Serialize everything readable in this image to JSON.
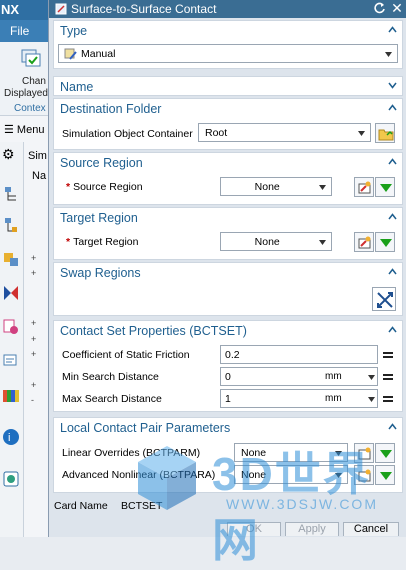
{
  "background": {
    "app_logo": "NX",
    "file_menu": "File",
    "ribbon_label_1": "Chan",
    "ribbon_label_2": "Displayed",
    "context_label": "Contex",
    "menu_label": "Menu",
    "navigator_label": "Sim",
    "column_label": "Na"
  },
  "dialog": {
    "title": "Surface-to-Surface Contact",
    "type": {
      "title": "Type",
      "selected": "Manual"
    },
    "name": {
      "title": "Name"
    },
    "destination": {
      "title": "Destination Folder",
      "label": "Simulation Object Container",
      "value": "Root"
    },
    "source": {
      "title": "Source Region",
      "label": "Source Region",
      "value": "None"
    },
    "target": {
      "title": "Target Region",
      "label": "Target Region",
      "value": "None"
    },
    "swap": {
      "title": "Swap Regions"
    },
    "contact_set": {
      "title": "Contact Set Properties (BCTSET)",
      "friction_label": "Coefficient of Static Friction",
      "friction_value": "0.2",
      "min_label": "Min Search Distance",
      "min_value": "0",
      "min_unit": "mm",
      "max_label": "Max Search Distance",
      "max_value": "1",
      "max_unit": "mm"
    },
    "local_pair": {
      "title": "Local Contact Pair Parameters",
      "linear_label": "Linear Overrides (BCTPARM)",
      "linear_value": "None",
      "advanced_label": "Advanced Nonlinear (BCTPARA)",
      "advanced_value": "None"
    },
    "card_name_label": "Card Name",
    "card_name_value": "BCTSET",
    "buttons": {
      "ok": "OK",
      "apply": "Apply",
      "cancel": "Cancel"
    }
  },
  "watermark": {
    "text": "3D世界网",
    "url": "WWW.3DSJW.COM"
  },
  "colors": {
    "title_bar": "#3a6d93",
    "section_title": "#1f5f8f",
    "required_mark": "#c00000",
    "accent_green": "#1aa01a"
  }
}
